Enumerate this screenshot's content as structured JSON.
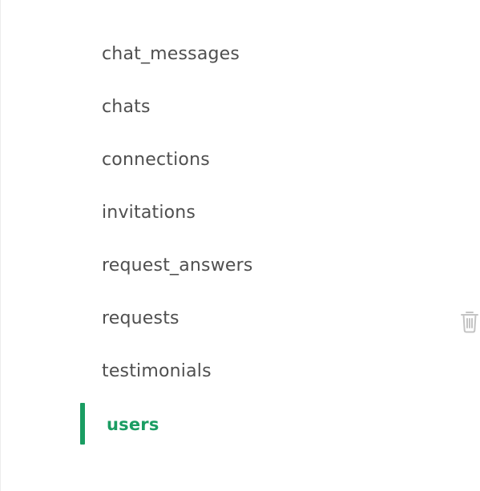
{
  "collections": {
    "items": [
      {
        "label": "chat_messages"
      },
      {
        "label": "chats"
      },
      {
        "label": "connections"
      },
      {
        "label": "invitations"
      },
      {
        "label": "request_answers"
      },
      {
        "label": "requests"
      },
      {
        "label": "testimonials"
      },
      {
        "label": "users"
      }
    ],
    "active_item": "users",
    "hover_item": "requests"
  },
  "icons": {
    "delete": "trash-icon"
  },
  "colors": {
    "text": "#4f4f4f",
    "accent": "#1a9d62",
    "icon": "#c4c4c4",
    "background": "#ffffff"
  }
}
